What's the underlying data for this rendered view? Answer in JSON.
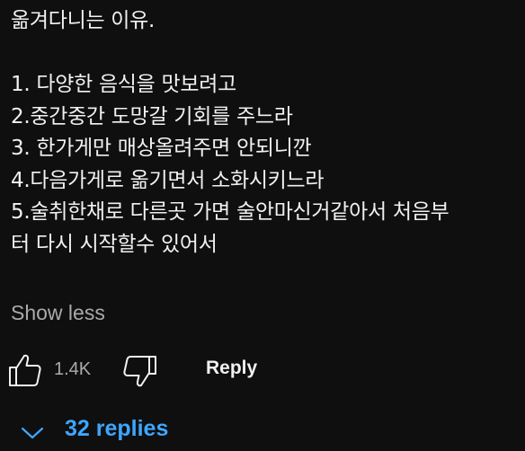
{
  "comment": {
    "lines": [
      "옮겨다니는 이유.",
      "",
      "1. 다양한 음식을 맛보려고",
      "2.중간중간 도망갈 기회를 주느라",
      "3. 한가게만 매상올려주면 안되니깐",
      "4.다음가게로 옮기면서 소화시키느라",
      "5.술취한채로 다른곳 가면 술안마신거같아서 처음부",
      "터 다시 시작할수 있어서"
    ],
    "show_less_label": "Show less"
  },
  "actions": {
    "like_icon": "thumbs-up-icon",
    "like_count": "1.4K",
    "dislike_icon": "thumbs-down-icon",
    "reply_label": "Reply"
  },
  "replies": {
    "toggle_icon": "chevron-down-icon",
    "label": "32 replies"
  },
  "colors": {
    "background": "#0f0f0f",
    "text": "#f1f1f1",
    "secondary_text": "#aaaaaa",
    "link": "#3ea6ff"
  }
}
